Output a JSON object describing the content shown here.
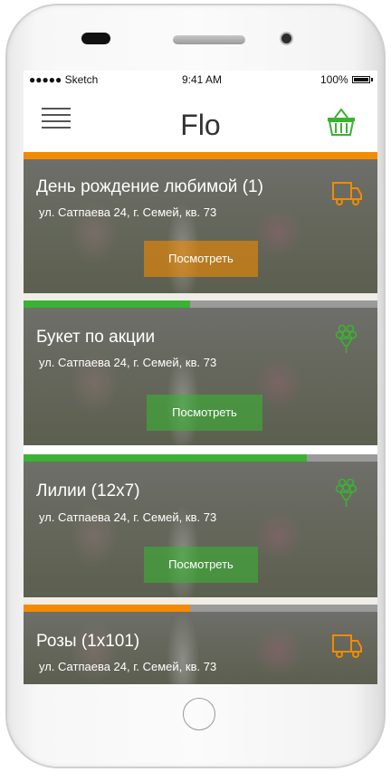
{
  "status": {
    "carrier": "●●●●● Sketch",
    "time": "9:41 AM",
    "battery": "100%"
  },
  "header": {
    "title": "Flo"
  },
  "colors": {
    "orange": "#f28b00",
    "green": "#3bb233"
  },
  "orders": [
    {
      "title": "День рождение любимой (1)",
      "address": "ул. Сатпаева 24, г. Семей, кв. 73",
      "button": "Посмотреть",
      "icon": "delivery-truck-icon"
    },
    {
      "title": "Букет по акции",
      "address": "ул. Сатпаева 24, г. Семей, кв. 73",
      "button": "Посмотреть",
      "icon": "bouquet-icon",
      "progress": 0.47
    },
    {
      "title": "Лилии (12х7)",
      "address": "ул. Сатпаева 24, г. Семей, кв. 73",
      "button": "Посмотреть",
      "icon": "bouquet-icon",
      "progress": 0.8
    },
    {
      "title": "Розы  (1х101)",
      "address": "ул. Сатпаева 24, г. Семей, кв. 73",
      "icon": "delivery-truck-icon",
      "progress": 0.47
    }
  ]
}
